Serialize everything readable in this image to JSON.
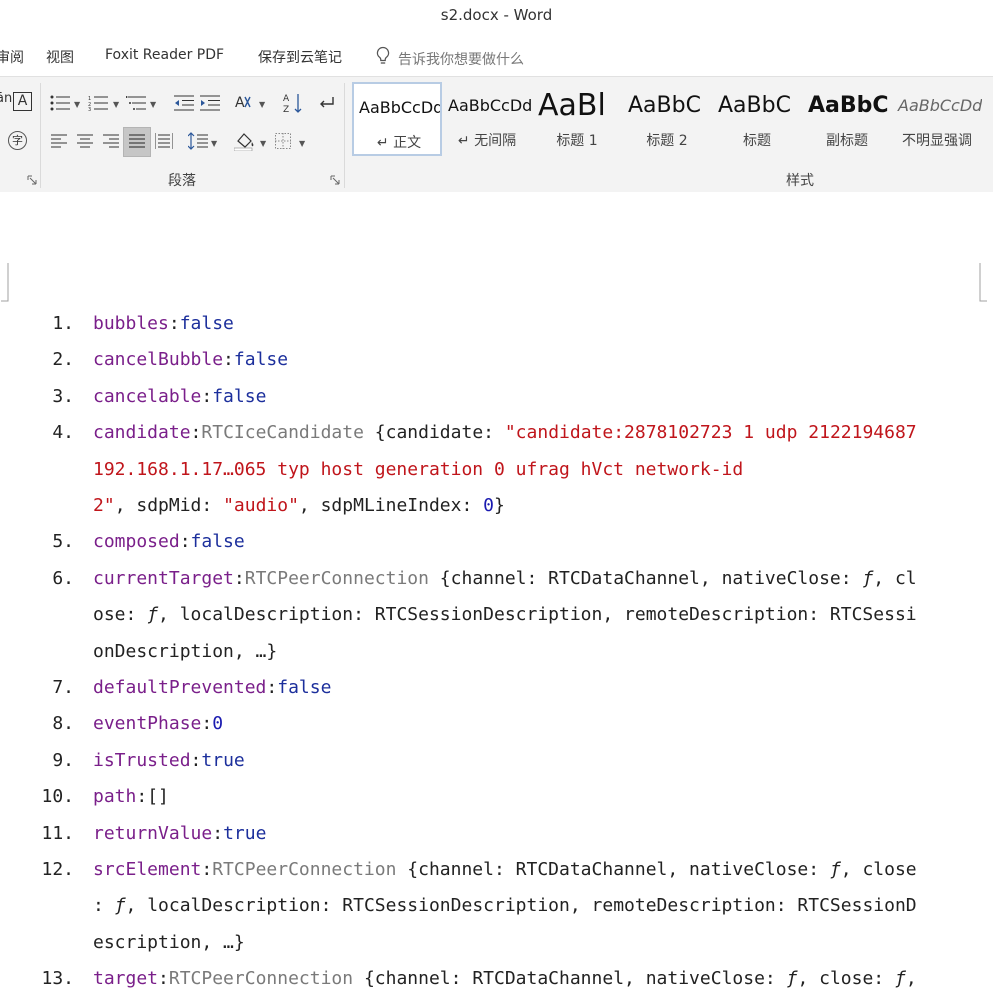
{
  "window": {
    "title": "s2.docx  -  Word"
  },
  "menu": {
    "tabs": [
      "审阅",
      "视图",
      "Foxit Reader PDF",
      "保存到云笔记"
    ],
    "tell_me": "告诉我你想要做什么"
  },
  "ribbon": {
    "paragraph_group_label": "段落",
    "styles_group_label": "样式",
    "styles": [
      {
        "sample": "AaBbCcDd",
        "name": "↵ 正文"
      },
      {
        "sample": "AaBbCcDd",
        "name": "↵ 无间隔"
      },
      {
        "sample": "AaBl",
        "name": "标题 1"
      },
      {
        "sample": "AaBbC",
        "name": "标题 2"
      },
      {
        "sample": "AaBbC",
        "name": "标题"
      },
      {
        "sample": "AaBbC",
        "name": "副标题"
      },
      {
        "sample": "AaBbCcDd",
        "name": "不明显强调"
      }
    ]
  },
  "colors": {
    "key": "#7a1f8a",
    "boolean": "#1c2f9c",
    "class": "#7a7a7a",
    "string": "#c0151b"
  },
  "icons": [
    "lightbulb-icon",
    "bullets-icon",
    "numbering-icon",
    "multilevel-list-icon",
    "decrease-indent-icon",
    "increase-indent-icon",
    "chinese-layout-icon",
    "sort-icon",
    "show-marks-icon",
    "align-left-icon",
    "center-icon",
    "align-right-icon",
    "justify-icon",
    "distributed-icon",
    "line-spacing-icon",
    "shading-icon",
    "borders-icon"
  ],
  "document": {
    "lines": [
      {
        "num": "1.",
        "segs": [
          [
            "k",
            "bubbles"
          ],
          [
            "p",
            ":"
          ],
          [
            "b",
            "false"
          ]
        ]
      },
      {
        "num": "2.",
        "segs": [
          [
            "k",
            "cancelBubble"
          ],
          [
            "p",
            ":"
          ],
          [
            "b",
            "false"
          ]
        ]
      },
      {
        "num": "3.",
        "segs": [
          [
            "k",
            "cancelable"
          ],
          [
            "p",
            ":"
          ],
          [
            "b",
            "false"
          ]
        ]
      },
      {
        "num": "4.",
        "segs": [
          [
            "k",
            "candidate"
          ],
          [
            "p",
            ":"
          ],
          [
            "c",
            "RTCIceCandidate"
          ],
          [
            "p",
            " {candidate: "
          ],
          [
            "s",
            "\"candidate:2878102723 1 udp 2122194687"
          ]
        ]
      },
      {
        "num": "",
        "segs": [
          [
            "s",
            "192.168.1.17…065 typ host generation 0 ufrag hVct network-id"
          ]
        ]
      },
      {
        "num": "",
        "segs": [
          [
            "s",
            "2\""
          ],
          [
            "p",
            ", sdpMid: "
          ],
          [
            "s",
            "\"audio\""
          ],
          [
            "p",
            ", sdpMLineIndex: "
          ],
          [
            "n",
            "0"
          ],
          [
            "p",
            "}"
          ]
        ]
      },
      {
        "num": "5.",
        "segs": [
          [
            "k",
            "composed"
          ],
          [
            "p",
            ":"
          ],
          [
            "b",
            "false"
          ]
        ]
      },
      {
        "num": "6.",
        "segs": [
          [
            "k",
            "currentTarget"
          ],
          [
            "p",
            ":"
          ],
          [
            "c",
            "RTCPeerConnection"
          ],
          [
            "p",
            " {channel: RTCDataChannel, nativeClose: "
          ],
          [
            "f",
            "ƒ"
          ],
          [
            "p",
            ", cl"
          ]
        ]
      },
      {
        "num": "",
        "segs": [
          [
            "p",
            "ose: "
          ],
          [
            "f",
            "ƒ"
          ],
          [
            "p",
            ", localDescription: RTCSessionDescription, remoteDescription: RTCSessi"
          ]
        ]
      },
      {
        "num": "",
        "segs": [
          [
            "p",
            "onDescription, …}"
          ]
        ]
      },
      {
        "num": "7.",
        "segs": [
          [
            "k",
            "defaultPrevented"
          ],
          [
            "p",
            ":"
          ],
          [
            "b",
            "false"
          ]
        ]
      },
      {
        "num": "8.",
        "segs": [
          [
            "k",
            "eventPhase"
          ],
          [
            "p",
            ":"
          ],
          [
            "n",
            "0"
          ]
        ]
      },
      {
        "num": "9.",
        "segs": [
          [
            "k",
            "isTrusted"
          ],
          [
            "p",
            ":"
          ],
          [
            "b",
            "true"
          ]
        ]
      },
      {
        "num": "10.",
        "segs": [
          [
            "k",
            "path"
          ],
          [
            "p",
            ":[]"
          ]
        ]
      },
      {
        "num": "11.",
        "segs": [
          [
            "k",
            "returnValue"
          ],
          [
            "p",
            ":"
          ],
          [
            "b",
            "true"
          ]
        ]
      },
      {
        "num": "12.",
        "segs": [
          [
            "k",
            "srcElement"
          ],
          [
            "p",
            ":"
          ],
          [
            "c",
            "RTCPeerConnection"
          ],
          [
            "p",
            " {channel: RTCDataChannel, nativeClose: "
          ],
          [
            "f",
            "ƒ"
          ],
          [
            "p",
            ", close"
          ]
        ]
      },
      {
        "num": "",
        "segs": [
          [
            "p",
            ": "
          ],
          [
            "f",
            "ƒ"
          ],
          [
            "p",
            ", localDescription: RTCSessionDescription, remoteDescription: RTCSessionD"
          ]
        ]
      },
      {
        "num": "",
        "segs": [
          [
            "p",
            "escription, …}"
          ]
        ]
      },
      {
        "num": "13.",
        "segs": [
          [
            "k",
            "target"
          ],
          [
            "p",
            ":"
          ],
          [
            "c",
            "RTCPeerConnection"
          ],
          [
            "p",
            " {channel: RTCDataChannel, nativeClose: "
          ],
          [
            "f",
            "ƒ"
          ],
          [
            "p",
            ", close: "
          ],
          [
            "f",
            "ƒ"
          ],
          [
            "p",
            ","
          ]
        ]
      }
    ]
  }
}
